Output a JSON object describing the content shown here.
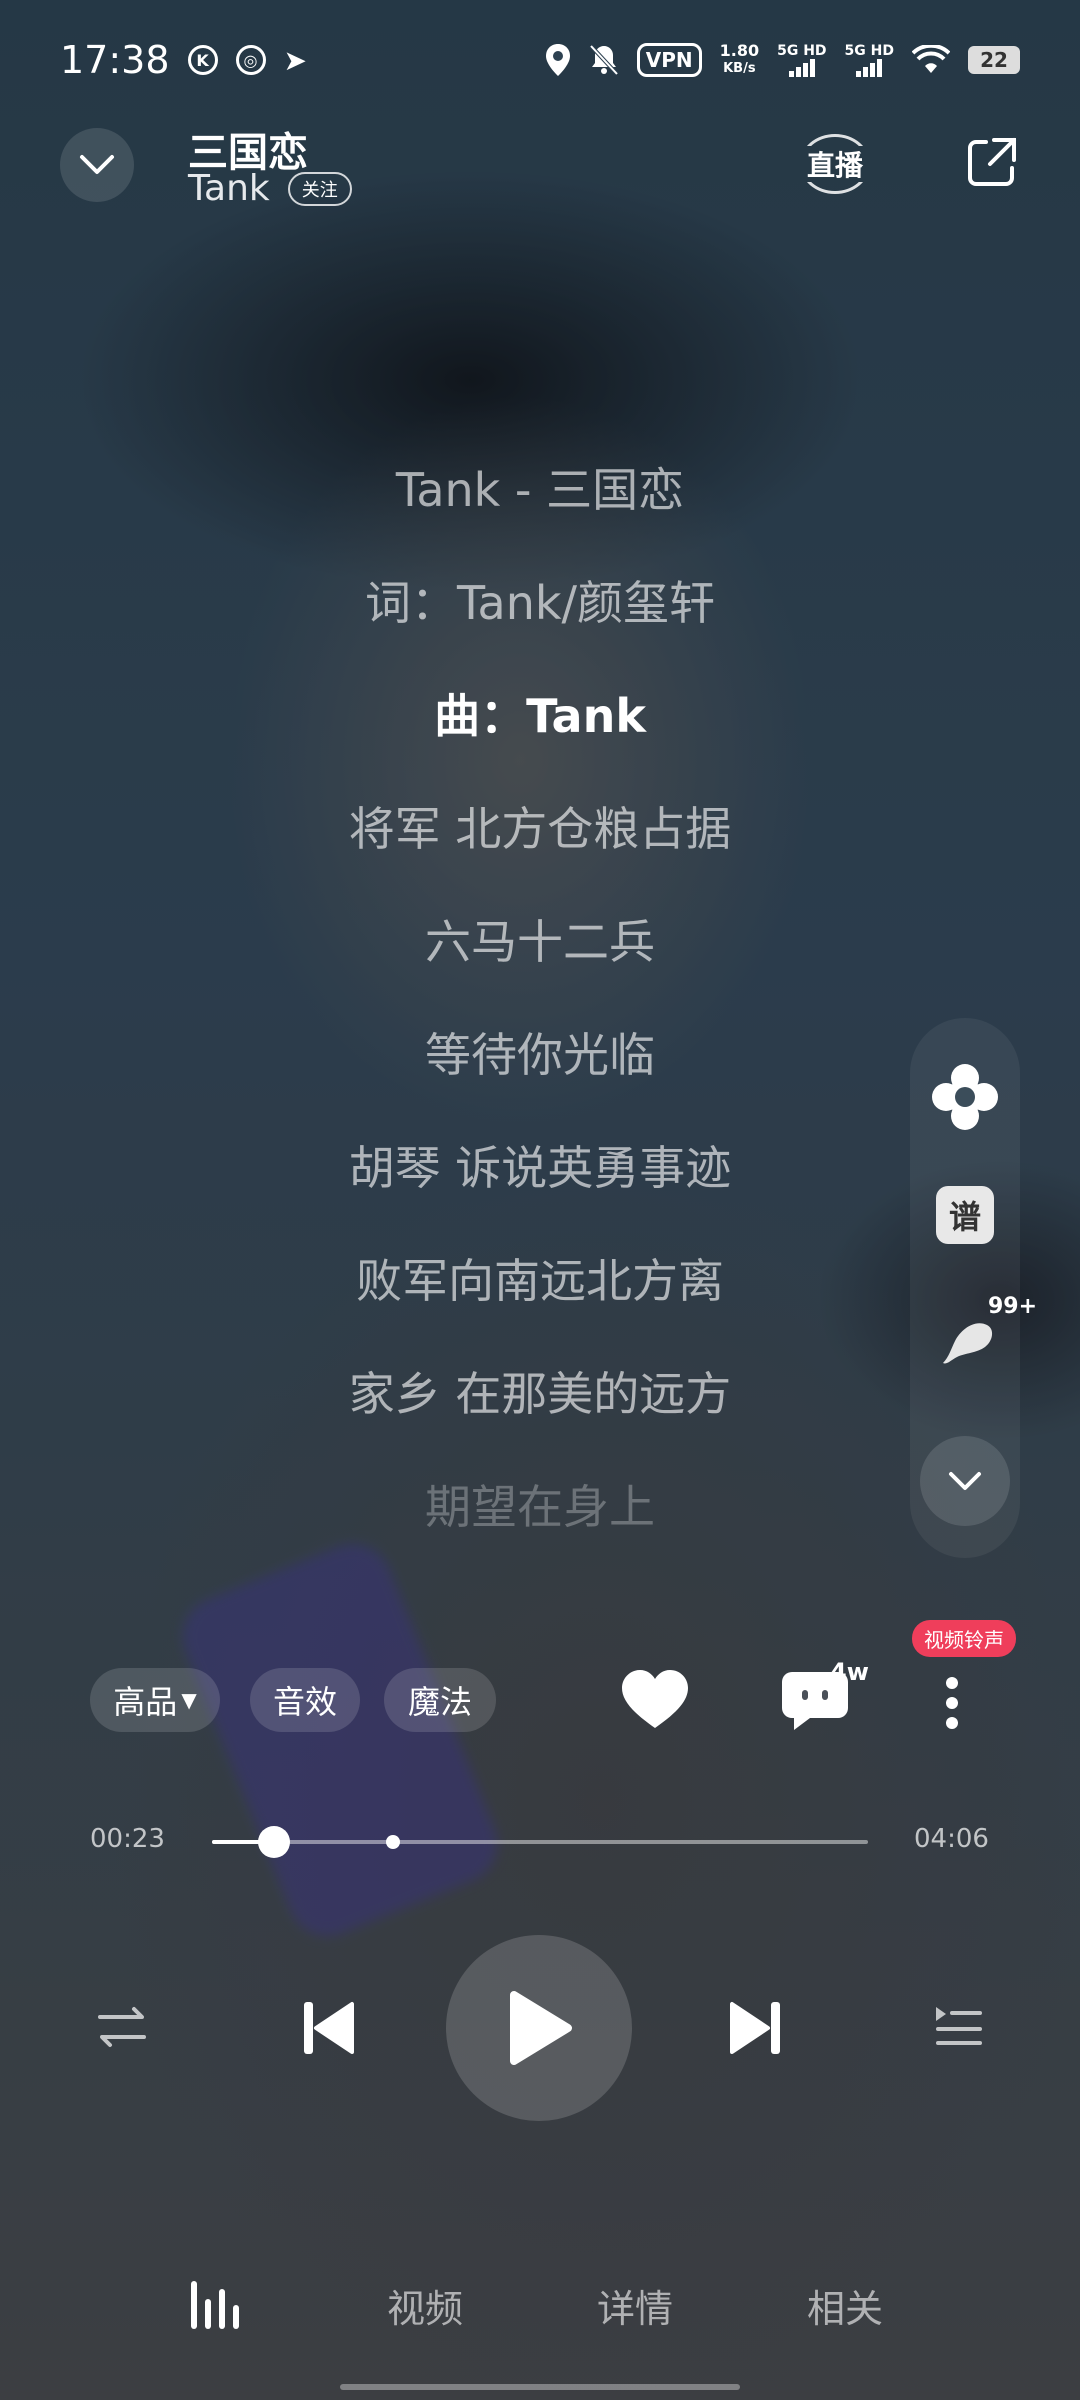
{
  "status_bar": {
    "time": "17:38",
    "vpn": "VPN",
    "net_speed_value": "1.80",
    "net_speed_unit": "KB/s",
    "signal_1": "5G HD",
    "signal_2": "5G HD",
    "battery": "22",
    "icons": [
      "k-icon",
      "hotspot-icon",
      "plane-icon",
      "location-icon",
      "mute-icon",
      "wifi-icon"
    ]
  },
  "header": {
    "song_title": "三国恋",
    "artist": "Tank",
    "follow_label": "关注",
    "live_label": "直播"
  },
  "lyrics": [
    "Tank - 三国恋",
    "词：Tank/颜玺轩",
    "曲：Tank",
    "将军 北方仓粮占据",
    "六马十二兵",
    "等待你光临",
    "胡琴 诉说英勇事迹",
    "败军向南远北方离",
    "家乡 在那美的远方",
    "期望在身上"
  ],
  "lyrics_active_index": 2,
  "side_tools": {
    "score_label": "谱",
    "tips_badge": "99+"
  },
  "actions": {
    "quality_label": "高品",
    "effects_label": "音效",
    "magic_label": "魔法",
    "comment_count": "4w",
    "ringtone_badge": "视频铃声"
  },
  "progress": {
    "current_time": "00:23",
    "total_time": "04:06",
    "played_fraction": 0.094,
    "buffered_fraction": 0.276
  },
  "bottom_tabs": [
    "视频",
    "详情",
    "相关"
  ],
  "colors": {
    "ringtone_badge": "#ef3e5b",
    "background": "#2d4151"
  }
}
